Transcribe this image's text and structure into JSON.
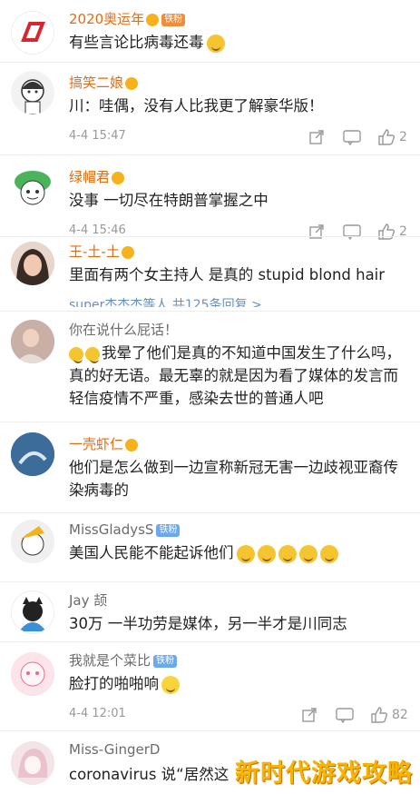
{
  "comments": [
    {
      "name": "2020奥运年",
      "text": "有些言论比病毒还毒",
      "badge": "铁粉"
    },
    {
      "name": "搞笑二娘",
      "text": "川：哇偶，没有人比我更了解豪华版！",
      "time": "4-4 15:47",
      "likes": "2"
    },
    {
      "name": "绿帽君",
      "text": "没事 一切尽在特朗普掌握之中",
      "time": "4-4 15:46",
      "likes": "2"
    },
    {
      "name": "王-土-土",
      "text": "里面有两个女主持人 是真的 stupid blond hair",
      "partial": "super杰杰杰等人 共125条回复 >"
    },
    {
      "name": "你在说什么屁话！",
      "text": "我晕了他们是真的不知道中国发生了什么吗，真的好无语。最无辜的就是因为看了媒体的发言而轻信疫情不严重，感染去世的普通人吧"
    },
    {
      "name": "一壳虾仁",
      "text": "他们是怎么做到一边宣称新冠无害一边歧视亚裔传染病毒的"
    },
    {
      "name": "MissGladysS",
      "badge": "铁粉",
      "text": "美国人民能不能起诉他们"
    },
    {
      "name": "Jay 颉",
      "text": "30万 一半功劳是媒体，另一半才是川同志"
    },
    {
      "name": "我就是个菜比",
      "badge": "铁粉",
      "text": "脸打的啪啪响",
      "time": "4-4 12:01",
      "likes": "82"
    },
    {
      "name": "Miss-GingerD",
      "text": "coronavirus 说“居然这"
    }
  ],
  "watermark": "新时代游戏攻略",
  "colors": {
    "name_orange": "#e86a10",
    "name_gray": "#6b6b6b",
    "badge_blue": "#6aa9ef",
    "badge_orange": "#f08c3a"
  }
}
